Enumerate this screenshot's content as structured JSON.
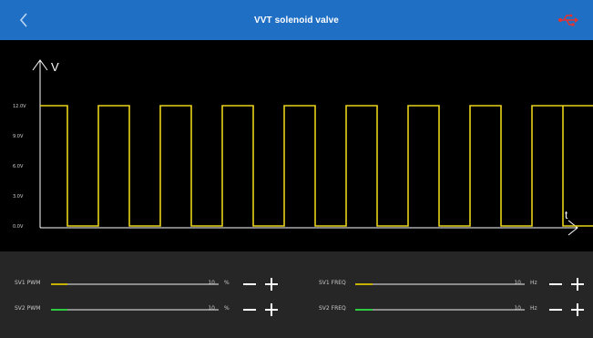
{
  "header": {
    "title": "VVT solenoid valve",
    "back_icon": "chevron-left-icon",
    "usb_icon": "usb-icon"
  },
  "colors": {
    "header_bg": "#1f6fc4",
    "waveform": "#e8d21a",
    "axis": "#ffffff",
    "usb": "#e8322c",
    "pwm1": "#c8b400",
    "pwm2": "#2ecc40"
  },
  "chart_data": {
    "type": "line",
    "y_axis_label": "V",
    "x_axis_label": "t",
    "y_ticks": [
      "12.0V",
      "9.0V",
      "6.0V",
      "3.0V",
      "0.0V"
    ],
    "y_tick_values": [
      12,
      9,
      6,
      3,
      0
    ],
    "ylim": [
      0,
      12
    ],
    "series": [
      {
        "pulses": 9,
        "high_value": 12,
        "low_value": 0
      }
    ]
  },
  "controls": {
    "sv1_pwm": {
      "label": "SV1 PWM",
      "value": "10",
      "unit": "%",
      "level": 0.1
    },
    "sv2_pwm": {
      "label": "SV2 PWM",
      "value": "10",
      "unit": "%",
      "level": 0.1
    },
    "sv1_freq": {
      "label": "SV1 FREQ",
      "value": "10",
      "unit": "Hz",
      "level": 0.1
    },
    "sv2_freq": {
      "label": "SV2 FREQ",
      "value": "10",
      "unit": "Hz",
      "level": 0.1
    }
  }
}
